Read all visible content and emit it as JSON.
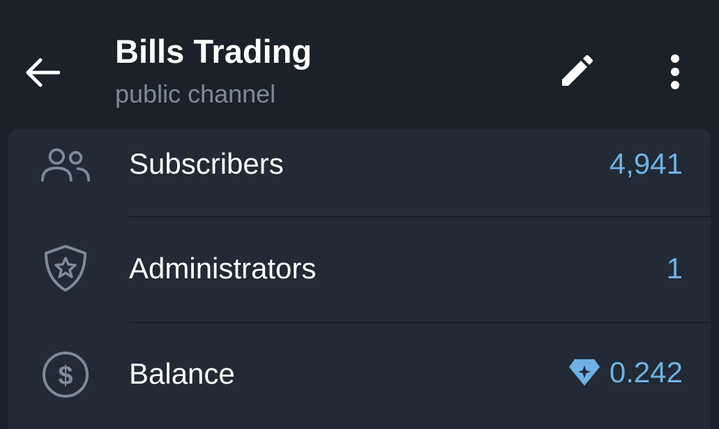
{
  "header": {
    "title": "Bills Trading",
    "subtitle": "public channel",
    "back_icon": "arrow-left-icon",
    "edit_icon": "pencil-icon",
    "more_icon": "more-vertical-icon"
  },
  "rows": [
    {
      "label": "Subscribers",
      "value": "4,941",
      "icon": "users-icon"
    },
    {
      "label": "Administrators",
      "value": "1",
      "icon": "shield-star-icon"
    },
    {
      "label": "Balance",
      "value": "0.242",
      "icon": "dollar-circle-icon",
      "value_icon": "ton-diamond-icon"
    }
  ],
  "colors": {
    "background": "#1b2129",
    "card": "#212a35",
    "accent": "#6fb1e4",
    "icon": "#7d8b98",
    "subtitle": "#7d8b98"
  }
}
